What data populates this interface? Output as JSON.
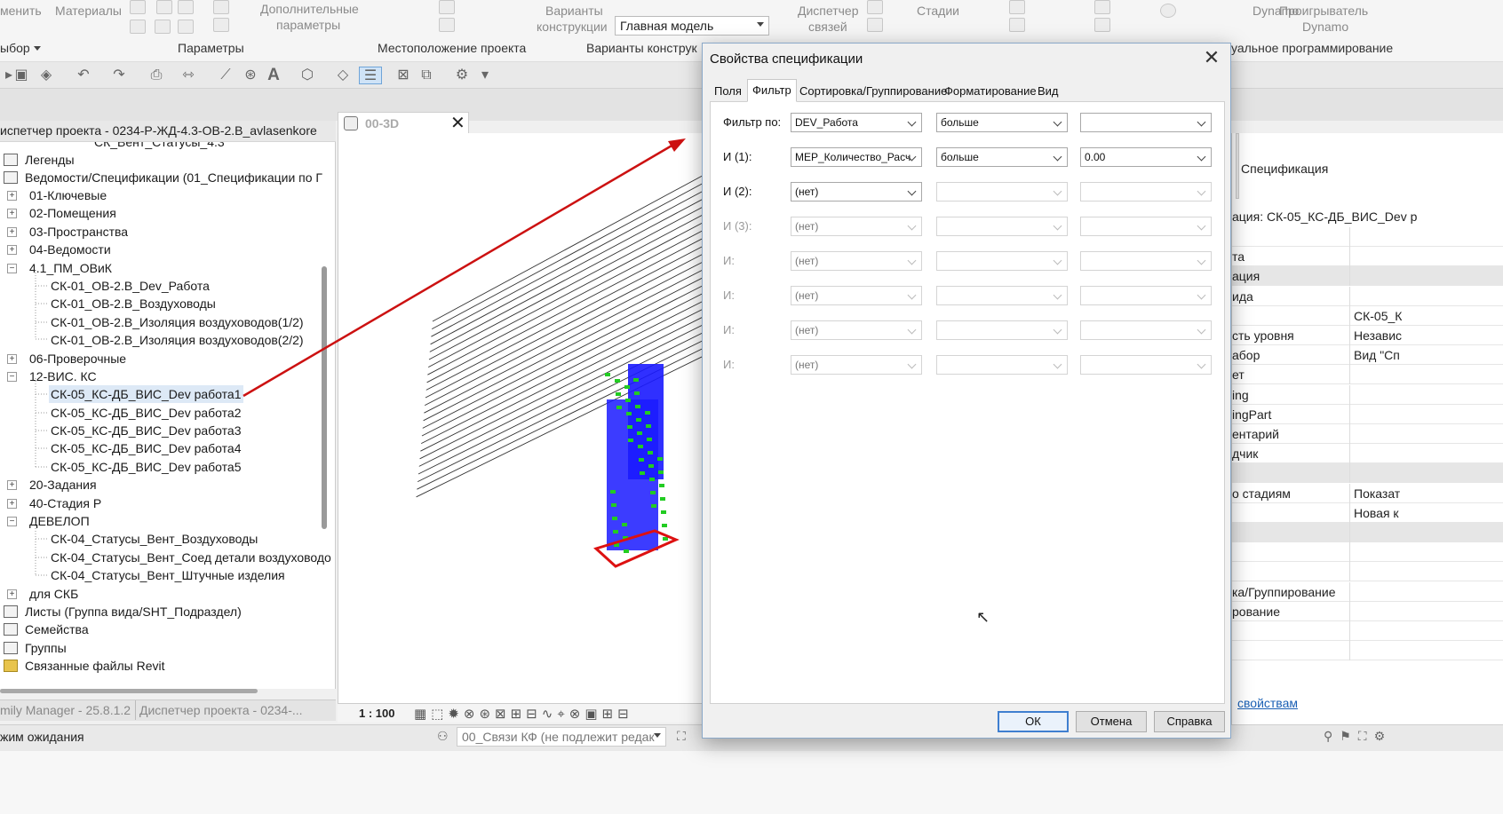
{
  "ribbon": {
    "left_cut": "менить",
    "materials": "Материалы",
    "extra_params_1": "Дополнительные",
    "extra_params_2": "параметры",
    "variants_1": "Варианты",
    "variants_2": "конструкции",
    "main_model": "Главная модель",
    "links_mgr_1": "Диспетчер",
    "links_mgr_2": "связей",
    "phases": "Стадии",
    "dynamo": "Dynamo",
    "player_1": "Проигрыватель",
    "player_2": "Dynamo",
    "panel_select": "ыбор",
    "panel_params": "Параметры",
    "panel_location": "Местоположение проекта",
    "panel_variants": "Варианты конструк",
    "panel_visual": "уальное программирование"
  },
  "browser": {
    "title": "испетчер проекта - 0234-Р-ЖД-4.3-ОВ-2.В_avlasenkore",
    "items": [
      {
        "label": "СК_Вент_Статусы_4.3"
      },
      {
        "label": "Легенды"
      },
      {
        "label": "Ведомости/Спецификации (01_Спецификации по Г"
      },
      {
        "label": "01-Ключевые"
      },
      {
        "label": "02-Помещения"
      },
      {
        "label": "03-Пространства"
      },
      {
        "label": "04-Ведомости"
      },
      {
        "label": "4.1_ПМ_ОВиК"
      },
      {
        "label": "СК-01_ОВ-2.В_Dev_Работа"
      },
      {
        "label": "СК-01_ОВ-2.В_Воздуховоды"
      },
      {
        "label": "СК-01_ОВ-2.В_Изоляция воздуховодов(1/2)"
      },
      {
        "label": "СК-01_ОВ-2.В_Изоляция воздуховодов(2/2)"
      },
      {
        "label": "06-Проверочные"
      },
      {
        "label": "12-ВИС. КС"
      },
      {
        "label": "СК-05_КС-ДБ_ВИС_Dev работа1"
      },
      {
        "label": "СК-05_КС-ДБ_ВИС_Dev работа2"
      },
      {
        "label": "СК-05_КС-ДБ_ВИС_Dev работа3"
      },
      {
        "label": "СК-05_КС-ДБ_ВИС_Dev работа4"
      },
      {
        "label": "СК-05_КС-ДБ_ВИС_Dev работа5"
      },
      {
        "label": "20-Задания"
      },
      {
        "label": "40-Стадия Р"
      },
      {
        "label": "ДЕВЕЛОП"
      },
      {
        "label": "СК-04_Статусы_Вент_Воздуховоды"
      },
      {
        "label": "СК-04_Статусы_Вент_Соед детали воздуховодо"
      },
      {
        "label": "СК-04_Статусы_Вент_Штучные изделия"
      },
      {
        "label": "для СКБ"
      },
      {
        "label": "Листы (Группа вида/SHT_Подраздел)"
      },
      {
        "label": "Семейства"
      },
      {
        "label": "Группы"
      },
      {
        "label": "Связанные файлы Revit"
      }
    ]
  },
  "view": {
    "tab_label": "00-3D",
    "scale": "1 : 100"
  },
  "bottom_tabs": [
    "mily Manager - 25.8.1.2",
    "Диспетчер проекта - 0234-..."
  ],
  "status": {
    "text": "жим ожидания",
    "workset": "00_Связи КФ (не подлежит редак",
    "link_text": "свойствам"
  },
  "props": {
    "type_label": "Спецификация",
    "instance_label": "ация: СК-05_КС-ДБ_ВИС_Dev р",
    "rows": [
      {
        "a": "",
        "b": ""
      },
      {
        "a": "та",
        "b": ""
      },
      {
        "a": "ация",
        "b": "",
        "group": true
      },
      {
        "a": "ида",
        "b": ""
      },
      {
        "a": "",
        "b": "СК-05_К"
      },
      {
        "a": "сть уровня",
        "b": "Независ"
      },
      {
        "a": "абор",
        "b": "Вид \"Сп"
      },
      {
        "a": "ет",
        "b": ""
      },
      {
        "a": "ing",
        "b": ""
      },
      {
        "a": "ingPart",
        "b": ""
      },
      {
        "a": "ентарий",
        "b": ""
      },
      {
        "a": "дчик",
        "b": ""
      },
      {
        "a": "",
        "b": "",
        "group": true
      },
      {
        "a": "о стадиям",
        "b": "Показат"
      },
      {
        "a": "",
        "b": "Новая к"
      },
      {
        "a": "",
        "b": "",
        "group": true
      },
      {
        "a": "",
        "b": ""
      },
      {
        "a": "",
        "b": ""
      },
      {
        "a": "ка/Группирование",
        "b": ""
      },
      {
        "a": "рование",
        "b": ""
      },
      {
        "a": "",
        "b": ""
      },
      {
        "a": "",
        "b": ""
      }
    ]
  },
  "dialog": {
    "title": "Свойства спецификации",
    "tabs": [
      "Поля",
      "Фильтр",
      "Сортировка/Группирование",
      "Форматирование",
      "Вид"
    ],
    "active_tab": "Фильтр",
    "rows": [
      {
        "label": "Фильтр по:",
        "field": "DEV_Работа",
        "op": "больше",
        "value": "",
        "enabled": true
      },
      {
        "label": "И (1):",
        "field": "MEP_Количество_Расч",
        "op": "больше",
        "value": "0.00",
        "enabled": true
      },
      {
        "label": "И (2):",
        "field": "(нет)",
        "op": "",
        "value": "",
        "enabled": true
      },
      {
        "label": "И (3):",
        "field": "(нет)",
        "op": "",
        "value": "",
        "enabled": false
      },
      {
        "label": "И:",
        "field": "(нет)",
        "op": "",
        "value": "",
        "enabled": false
      },
      {
        "label": "И:",
        "field": "(нет)",
        "op": "",
        "value": "",
        "enabled": false
      },
      {
        "label": "И:",
        "field": "(нет)",
        "op": "",
        "value": "",
        "enabled": false
      },
      {
        "label": "И:",
        "field": "(нет)",
        "op": "",
        "value": "",
        "enabled": false
      }
    ],
    "ok": "ОК",
    "cancel": "Отмена",
    "help": "Справка"
  },
  "colors": {
    "arrow": "#cc1111",
    "model_blue": "#1a1aff",
    "accent": "#3f7fd0"
  }
}
